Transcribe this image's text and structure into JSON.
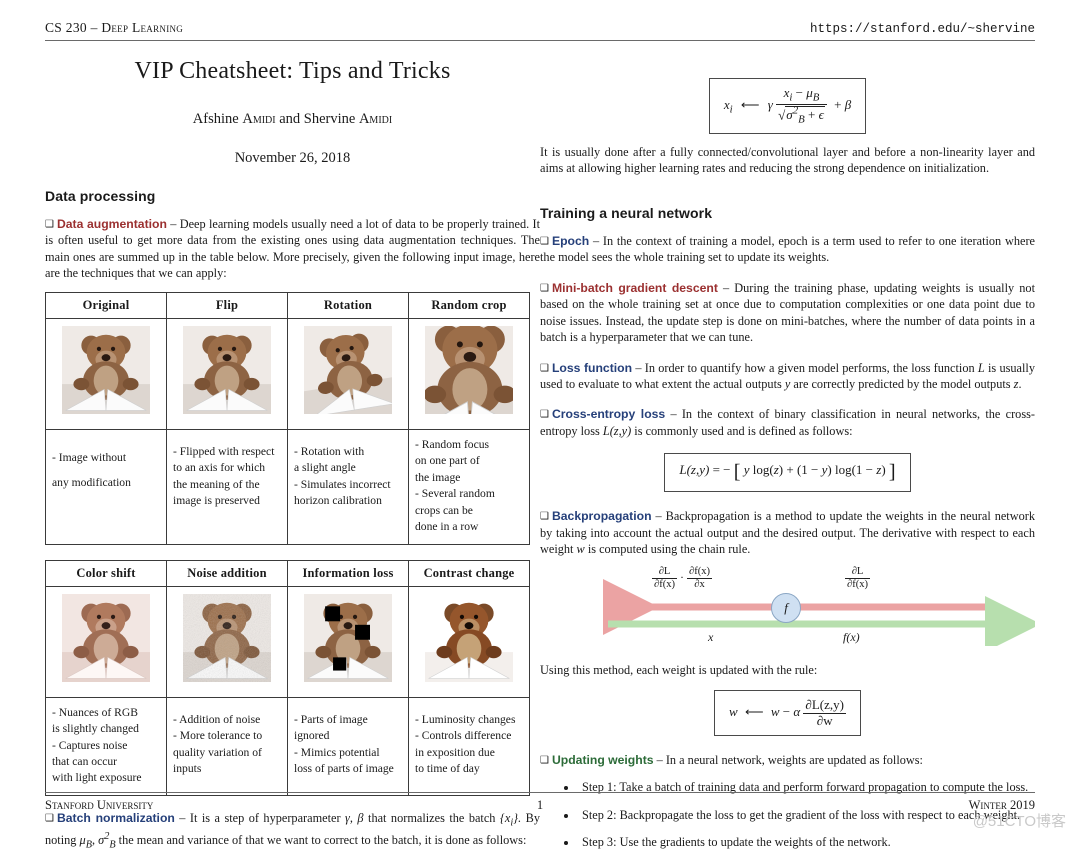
{
  "header": {
    "course": "CS 230 – Deep Learning",
    "url": "https://stanford.edu/~shervine"
  },
  "title_block": {
    "title": "VIP Cheatsheet: Tips and Tricks",
    "authors": "Afshine Amidi and Shervine Amidi",
    "date": "November 26, 2018"
  },
  "left_column": {
    "section_title": "Data processing",
    "data_augmentation": {
      "term": "Data augmentation",
      "color": "#9b3030",
      "body": "– Deep learning models usually need a lot of data to be properly trained. It is often useful to get more data from the existing ones using data augmentation techniques. The main ones are summed up in the table below. More precisely, given the following input image, here are the techniques that we can apply:"
    },
    "table1": {
      "headers": [
        "Original",
        "Flip",
        "Rotation",
        "Random crop"
      ],
      "descriptions": [
        [
          "- Image without",
          "",
          "any modification"
        ],
        [
          "- Flipped with respect",
          "to an axis for which",
          "the meaning of the",
          "image is preserved"
        ],
        [
          "- Rotation with",
          "a slight angle",
          "- Simulates incorrect",
          "horizon calibration"
        ],
        [
          "- Random focus",
          "on one part of",
          "the image",
          "- Several random",
          "crops can be",
          "done in a row"
        ]
      ]
    },
    "table2": {
      "headers": [
        "Color shift",
        "Noise addition",
        "Information loss",
        "Contrast change"
      ],
      "descriptions": [
        [
          "- Nuances of RGB",
          "is slightly changed",
          "- Captures noise",
          "that can occur",
          "with light exposure"
        ],
        [
          "- Addition of noise",
          "- More tolerance to",
          "quality variation of",
          "inputs"
        ],
        [
          "- Parts of image",
          "ignored",
          "- Mimics potential",
          "loss of parts of image"
        ],
        [
          "- Luminosity changes",
          "- Controls difference",
          "in exposition due",
          "to time of day"
        ]
      ]
    },
    "batch_norm": {
      "term": "Batch normalization",
      "color": "#26407a",
      "body_pre": "– It is a step of hyperparameter ",
      "params": "γ, β",
      "body_mid": " that normalizes the batch ",
      "batch_sym": "{x",
      "batch_sub": "i",
      "batch_close": "}.",
      "body_post": "By noting μB, σ²B the mean and variance of that we want to correct to the batch, it is done as follows:"
    }
  },
  "right_column": {
    "batchnorm_formula": {
      "lhs": "x",
      "lhs_sub": "i",
      "arrow": "⟵",
      "gamma": "γ",
      "num": "x",
      "num_sub": "i",
      "num_rest": "− μ",
      "num_sub2": "B",
      "den_open": "√",
      "den": "σ²B + ϵ",
      "plus_beta": "+ β"
    },
    "batchnorm_note": "It is usually done after a fully connected/convolutional layer and before a non-linearity layer and aims at allowing higher learning rates and reducing the strong dependence on initialization.",
    "section_title": "Training a neural network",
    "epoch": {
      "term": "Epoch",
      "color": "#26407a",
      "body": "– In the context of training a model, epoch is a term used to refer to one iteration where the model sees the whole training set to update its weights."
    },
    "minibatch": {
      "term": "Mini-batch gradient descent",
      "color": "#9b3030",
      "body": "– During the training phase, updating weights is usually not based on the whole training set at once due to computation complexities or one data point due to noise issues. Instead, the update step is done on mini-batches, where the number of data points in a batch is a hyperparameter that we can tune."
    },
    "loss_function": {
      "term": "Loss function",
      "color": "#26407a",
      "body_1": "– In order to quantify how a given model performs, the loss function ",
      "sym_L": "L",
      "body_2": " is usually used to evaluate to what extent the actual outputs ",
      "sym_y": "y",
      "body_3": " are correctly predicted by the model outputs ",
      "sym_z": "z",
      "body_4": "."
    },
    "cross_entropy": {
      "term": "Cross-entropy loss",
      "color": "#26407a",
      "body_1": "– In the context of binary classification in neural networks, the cross-entropy loss ",
      "sym": "L(z,y)",
      "body_2": " is commonly used and is defined as follows:",
      "formula": "L(z,y) = − [ y log(z) + (1 − y) log(1 − z) ]"
    },
    "backpropagation": {
      "term": "Backpropagation",
      "color": "#26407a",
      "body_1": "– Backpropagation is a method to update the weights in the neural network by taking into account the actual output and the desired output. The derivative with respect to each weight ",
      "sym_w": "w",
      "body_2": " is computed using the chain rule."
    },
    "diagram": {
      "left_label_1_num": "∂L",
      "left_label_1_den": "∂f(x)",
      "left_label_dot": "·",
      "left_label_2_num": "∂f(x)",
      "left_label_2_den": "∂x",
      "right_label_num": "∂L",
      "right_label_den": "∂f(x)",
      "node": "f",
      "bottom_left": "x",
      "bottom_right": "f(x)",
      "backward_arrow_color": "#eba3a3",
      "forward_arrow_color": "#b7dfae",
      "node_fill": "#cfe0f2"
    },
    "update_rule_intro": "Using this method, each weight is updated with the rule:",
    "update_rule": {
      "lhs": "w",
      "arrow": "⟵",
      "rhs": "w − α",
      "frac_num": "∂L(z,y)",
      "frac_den": "∂w"
    },
    "updating_weights": {
      "term": "Updating weights",
      "color": "#2c6b38",
      "body": "– In a neural network, weights are updated as follows:"
    },
    "steps": [
      "Step 1: Take a batch of training data and perform forward propagation to compute the loss.",
      "Step 2: Backpropagate the loss to get the gradient of the loss with respect to each weight.",
      "Step 3: Use the gradients to update the weights of the network."
    ]
  },
  "footer": {
    "left": "Stanford University",
    "page": "1",
    "right": "Winter 2019",
    "watermark": "@51CTO博客"
  }
}
